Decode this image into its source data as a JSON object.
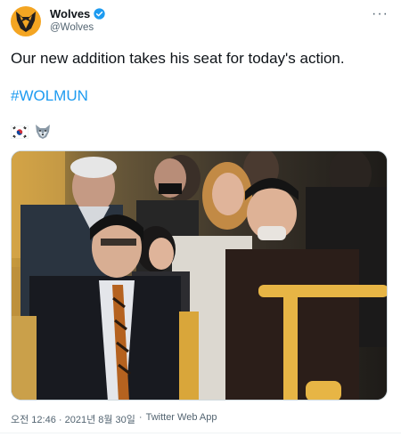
{
  "tweet": {
    "author_name": "Wolves",
    "author_handle": "@Wolves",
    "more_label": "···",
    "text": "Our new addition takes his seat for today's action.",
    "hashtag": "#WOLMUN",
    "emoji_icons": [
      "south-korea-flag-icon",
      "wolf-icon"
    ],
    "timestamp": "오전 12:46 · 2021년 8월 30일",
    "separator": "·",
    "source": "Twitter Web App"
  },
  "colors": {
    "brand": "#f4a522",
    "link": "#1d9bf0",
    "verified": "#1d9bf0",
    "secondary_text": "#536471"
  }
}
